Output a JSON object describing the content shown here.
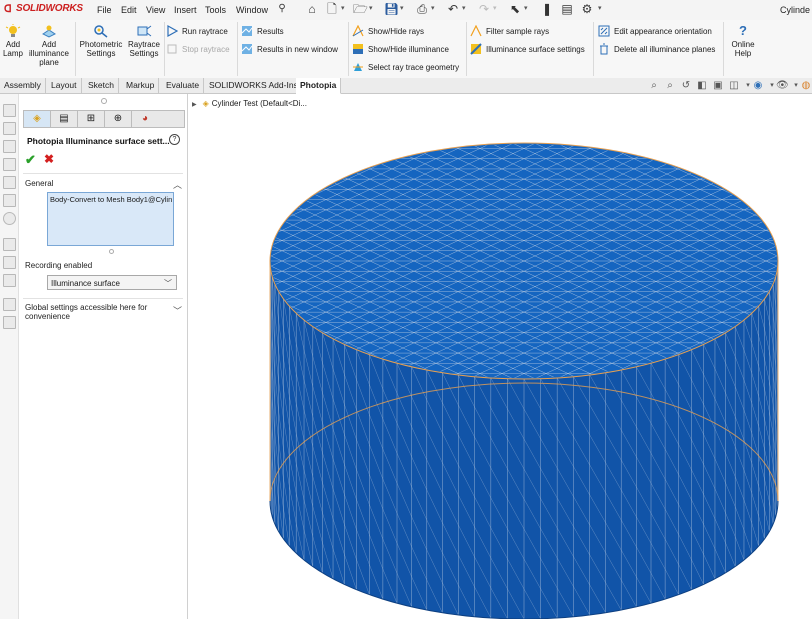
{
  "app": {
    "logo_text": "SOLIDWORKS",
    "document_title": "Cylinde",
    "menus": [
      "File",
      "Edit",
      "View",
      "Insert",
      "Tools",
      "Window"
    ]
  },
  "command_manager": {
    "add_lamp": "Add Lamp",
    "add_illuminance_plane": "Add illuminance plane",
    "photometric_settings": "Photometric Settings",
    "raytrace_settings": "Raytrace Settings",
    "run_raytrace": "Run raytrace",
    "stop_raytrace": "Stop raytrace",
    "results": "Results",
    "results_new_window": "Results in new window",
    "show_hide_rays": "Show/Hide rays",
    "show_hide_illuminance": "Show/Hide illuminance",
    "select_raytrace_geometry": "Select ray trace geometry",
    "filter_sample_rays": "Filter sample rays",
    "illuminance_surface_settings": "Illuminance surface settings",
    "edit_appearance_orientation": "Edit appearance orientation",
    "delete_all_illuminance_planes": "Delete all illuminance planes",
    "online_help": "Online Help"
  },
  "tabs": [
    {
      "label": "Assembly",
      "active": false
    },
    {
      "label": "Layout",
      "active": false
    },
    {
      "label": "Sketch",
      "active": false
    },
    {
      "label": "Markup",
      "active": false
    },
    {
      "label": "Evaluate",
      "active": false
    },
    {
      "label": "SOLIDWORKS Add-Ins",
      "active": false
    },
    {
      "label": "Photopia",
      "active": true
    }
  ],
  "property_manager": {
    "title": "Photopia Illuminance surface sett...",
    "general_label": "General",
    "selection_value": "Body-Convert to Mesh Body1@Cylin",
    "recording_label": "Recording enabled",
    "recording_value": "Illuminance surface",
    "global_settings_label": "Global settings accessible here for convenience"
  },
  "feature_tree": {
    "root_label": "Cylinder Test  (Default<Di..."
  },
  "colors": {
    "surface_blue": "#1565c0",
    "mesh_line": "#c9d6e6",
    "edge_orange": "#e8a050",
    "accent_red": "#cc1f1f",
    "ok_green": "#2aa02a",
    "cancel_red": "#d42020"
  }
}
